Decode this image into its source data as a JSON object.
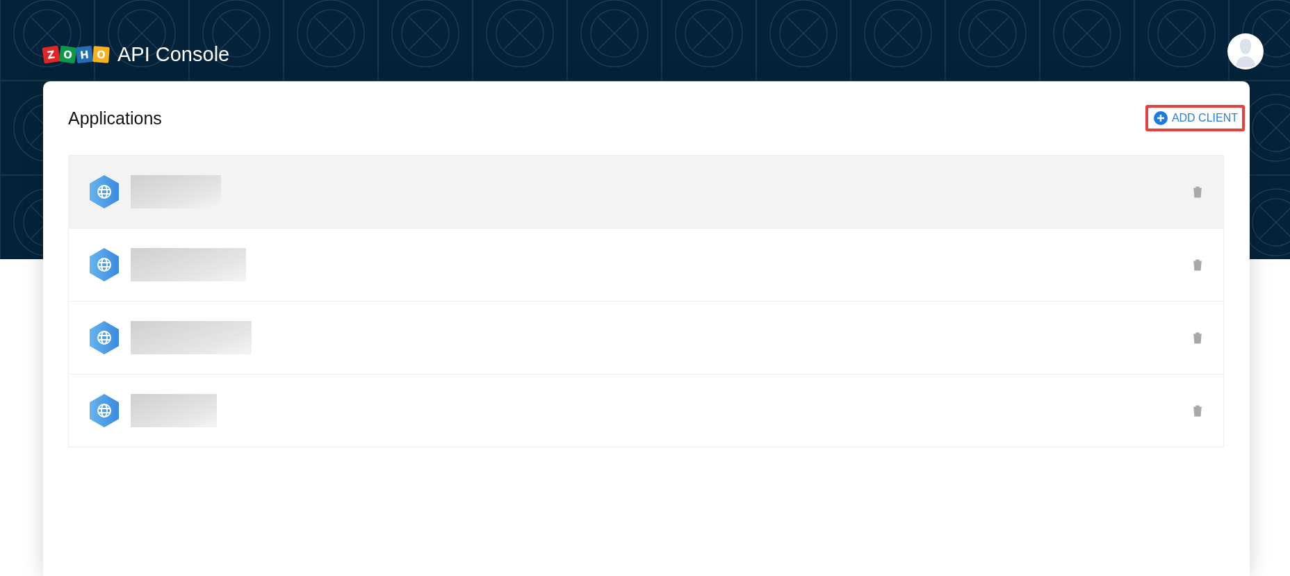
{
  "header": {
    "logo_letters": [
      {
        "letter": "Z",
        "color": "#e42527"
      },
      {
        "letter": "O",
        "color": "#089949"
      },
      {
        "letter": "H",
        "color": "#226db4"
      },
      {
        "letter": "O",
        "color": "#f9b21d"
      }
    ],
    "title": "API Console"
  },
  "panel": {
    "title": "Applications",
    "add_button": {
      "label": "ADD CLIENT",
      "highlighted": true
    },
    "clients": [
      {
        "highlighted": true
      },
      {
        "highlighted": false
      },
      {
        "highlighted": false
      },
      {
        "highlighted": false
      }
    ]
  }
}
